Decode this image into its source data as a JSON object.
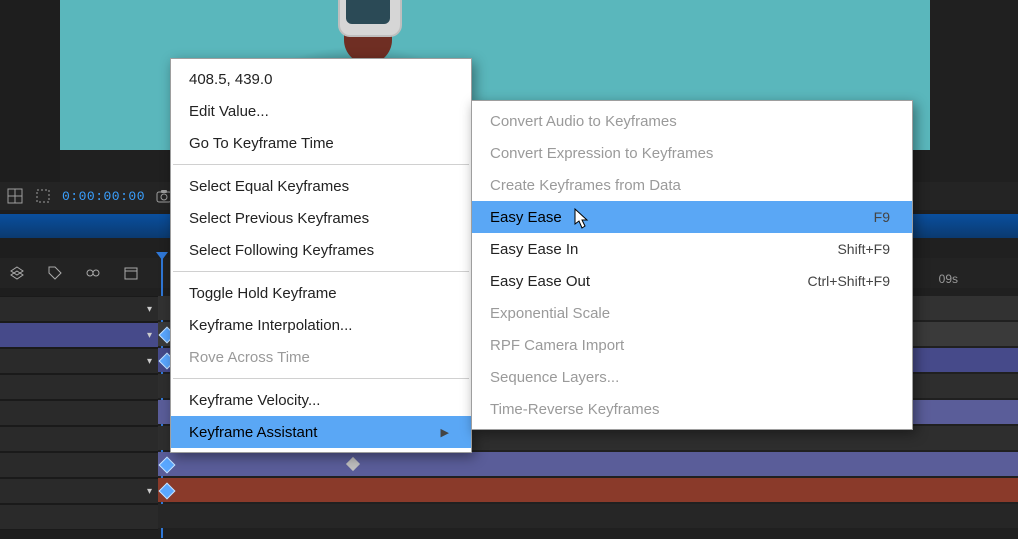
{
  "viewer": {
    "timecode": "0:00:00:00"
  },
  "ruler": {
    "mark": "09s"
  },
  "context_menu": {
    "value_readout": "408.5, 439.0",
    "items": {
      "edit_value": "Edit Value...",
      "goto_keyframe_time": "Go To Keyframe Time",
      "select_equal": "Select Equal Keyframes",
      "select_previous": "Select Previous Keyframes",
      "select_following": "Select Following Keyframes",
      "toggle_hold": "Toggle Hold Keyframe",
      "interpolation": "Keyframe Interpolation...",
      "rove": "Rove Across Time",
      "velocity": "Keyframe Velocity...",
      "assistant": "Keyframe Assistant"
    }
  },
  "assistant_submenu": {
    "convert_audio": "Convert Audio to Keyframes",
    "convert_expression": "Convert Expression to Keyframes",
    "create_from_data": "Create Keyframes from Data",
    "easy_ease": "Easy Ease",
    "easy_ease_shortcut": "F9",
    "easy_ease_in": "Easy Ease In",
    "easy_ease_in_shortcut": "Shift+F9",
    "easy_ease_out": "Easy Ease Out",
    "easy_ease_out_shortcut": "Ctrl+Shift+F9",
    "exponential": "Exponential Scale",
    "rpf": "RPF Camera Import",
    "sequence": "Sequence Layers...",
    "time_reverse": "Time-Reverse Keyframes"
  }
}
